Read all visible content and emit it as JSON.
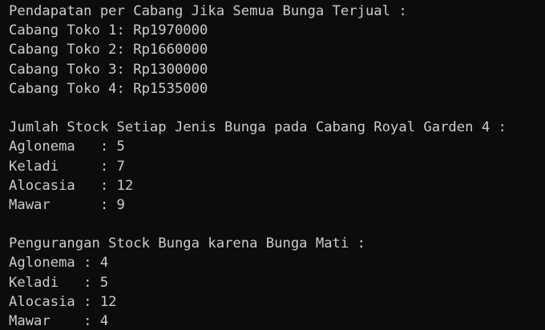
{
  "terminal": {
    "background": "#0c0c0c",
    "foreground": "#cccccc",
    "lines": [
      "Pendapatan per Cabang Jika Semua Bunga Terjual :",
      "Cabang Toko 1: Rp1970000",
      "Cabang Toko 2: Rp1660000",
      "Cabang Toko 3: Rp1300000",
      "Cabang Toko 4: Rp1535000",
      "",
      "Jumlah Stock Setiap Jenis Bunga pada Cabang Royal Garden 4 :",
      "Aglonema   : 5",
      "Keladi     : 7",
      "Alocasia   : 12",
      "Mawar      : 9",
      "",
      "Pengurangan Stock Bunga karena Bunga Mati :",
      "Aglonema : 4",
      "Keladi   : 5",
      "Alocasia : 12",
      "Mawar    : 4"
    ]
  }
}
